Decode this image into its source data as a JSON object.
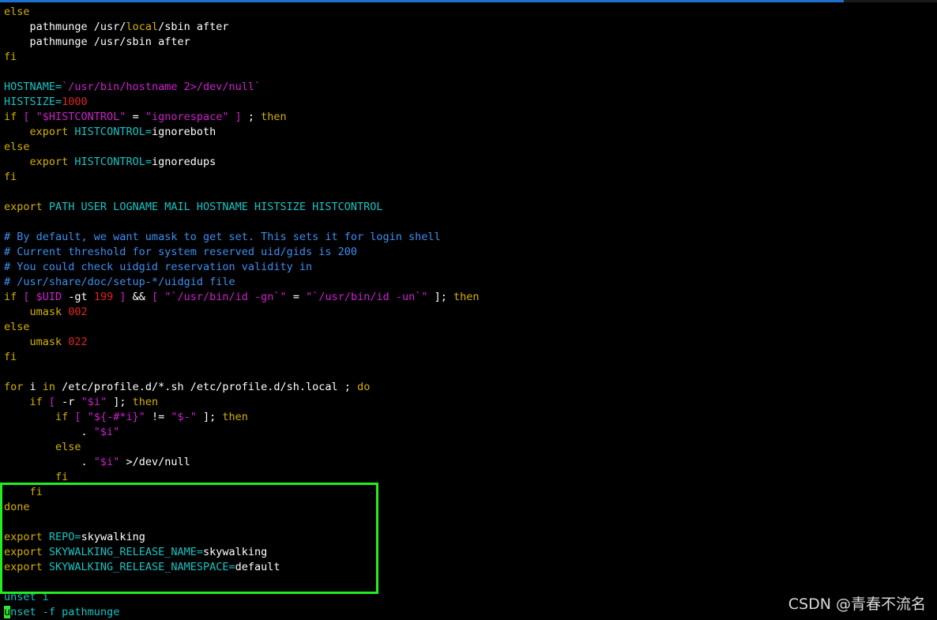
{
  "colors": {
    "background": "#000000",
    "keyword": "#d4b000",
    "variable": "#17c3c3",
    "string": "#d01fd0",
    "number": "#e0241f",
    "comment": "#3d8ef0",
    "text": "#ffffff",
    "highlight_border": "#22ee22",
    "cursor": "#33e633"
  },
  "editor": {
    "lines": [
      [
        {
          "t": "else",
          "c": "kw"
        }
      ],
      [
        {
          "t": "    pathmunge /usr/",
          "c": "txt"
        },
        {
          "t": "local",
          "c": "kw"
        },
        {
          "t": "/sbin after",
          "c": "txt"
        }
      ],
      [
        {
          "t": "    pathmunge /usr/sbin after",
          "c": "txt"
        }
      ],
      [
        {
          "t": "fi",
          "c": "kw"
        }
      ],
      [],
      [
        {
          "t": "HOSTNAME=",
          "c": "var"
        },
        {
          "t": "`/usr/bin/hostname 2>/dev/null`",
          "c": "str"
        }
      ],
      [
        {
          "t": "HISTSIZE=",
          "c": "var"
        },
        {
          "t": "1000",
          "c": "num"
        }
      ],
      [
        {
          "t": "if",
          "c": "kw"
        },
        {
          "t": " [ ",
          "c": "str"
        },
        {
          "t": "\"$HISTCONTROL\"",
          "c": "str"
        },
        {
          "t": " = ",
          "c": "txt"
        },
        {
          "t": "\"ignorespace\"",
          "c": "str"
        },
        {
          "t": " ] ",
          "c": "str"
        },
        {
          "t": "; ",
          "c": "txt"
        },
        {
          "t": "then",
          "c": "kw"
        }
      ],
      [
        {
          "t": "    ",
          "c": "txt"
        },
        {
          "t": "export",
          "c": "kw"
        },
        {
          "t": " HISTCONTROL=",
          "c": "var"
        },
        {
          "t": "ignoreboth",
          "c": "txt"
        }
      ],
      [
        {
          "t": "else",
          "c": "kw"
        }
      ],
      [
        {
          "t": "    ",
          "c": "txt"
        },
        {
          "t": "export",
          "c": "kw"
        },
        {
          "t": " HISTCONTROL=",
          "c": "var"
        },
        {
          "t": "ignoredups",
          "c": "txt"
        }
      ],
      [
        {
          "t": "fi",
          "c": "kw"
        }
      ],
      [],
      [
        {
          "t": "export",
          "c": "kw"
        },
        {
          "t": " PATH USER LOGNAME MAIL HOSTNAME HISTSIZE HISTCONTROL",
          "c": "var"
        }
      ],
      [],
      [
        {
          "t": "# By default, we want umask to get set. This sets it for login shell",
          "c": "com"
        }
      ],
      [
        {
          "t": "# Current threshold for system reserved uid/gids is 200",
          "c": "com"
        }
      ],
      [
        {
          "t": "# You could check uidgid reservation validity in",
          "c": "com"
        }
      ],
      [
        {
          "t": "# /usr/share/doc/setup-*/uidgid file",
          "c": "com"
        }
      ],
      [
        {
          "t": "if",
          "c": "kw"
        },
        {
          "t": " [ ",
          "c": "str"
        },
        {
          "t": "$UID",
          "c": "str"
        },
        {
          "t": " -gt ",
          "c": "txt"
        },
        {
          "t": "199",
          "c": "num"
        },
        {
          "t": " ] ",
          "c": "str"
        },
        {
          "t": "&& ",
          "c": "txt"
        },
        {
          "t": "[ ",
          "c": "str"
        },
        {
          "t": "\"`/usr/bin/id -gn`\"",
          "c": "str"
        },
        {
          "t": " = ",
          "c": "txt"
        },
        {
          "t": "\"`/usr/bin/id -un`\"",
          "c": "str"
        },
        {
          "t": " ]; ",
          "c": "txt"
        },
        {
          "t": "then",
          "c": "kw"
        }
      ],
      [
        {
          "t": "    umask ",
          "c": "kw"
        },
        {
          "t": "002",
          "c": "num"
        }
      ],
      [
        {
          "t": "else",
          "c": "kw"
        }
      ],
      [
        {
          "t": "    umask ",
          "c": "kw"
        },
        {
          "t": "022",
          "c": "num"
        }
      ],
      [
        {
          "t": "fi",
          "c": "kw"
        }
      ],
      [],
      [
        {
          "t": "for",
          "c": "kw"
        },
        {
          "t": " i ",
          "c": "txt"
        },
        {
          "t": "in",
          "c": "kw"
        },
        {
          "t": " /etc/profile.d/*.sh /etc/profile.d/sh.local ; ",
          "c": "txt"
        },
        {
          "t": "do",
          "c": "kw"
        }
      ],
      [
        {
          "t": "    ",
          "c": "txt"
        },
        {
          "t": "if",
          "c": "kw"
        },
        {
          "t": " [ ",
          "c": "str"
        },
        {
          "t": "-r ",
          "c": "txt"
        },
        {
          "t": "\"$i\"",
          "c": "str"
        },
        {
          "t": " ]; ",
          "c": "txt"
        },
        {
          "t": "then",
          "c": "kw"
        }
      ],
      [
        {
          "t": "        ",
          "c": "txt"
        },
        {
          "t": "if",
          "c": "kw"
        },
        {
          "t": " [ ",
          "c": "str"
        },
        {
          "t": "\"${-#*i}\"",
          "c": "str"
        },
        {
          "t": " != ",
          "c": "txt"
        },
        {
          "t": "\"$-\"",
          "c": "str"
        },
        {
          "t": " ]; ",
          "c": "txt"
        },
        {
          "t": "then",
          "c": "kw"
        }
      ],
      [
        {
          "t": "            . ",
          "c": "txt"
        },
        {
          "t": "\"$i\"",
          "c": "str"
        }
      ],
      [
        {
          "t": "        else",
          "c": "kw"
        }
      ],
      [
        {
          "t": "            . ",
          "c": "txt"
        },
        {
          "t": "\"$i\"",
          "c": "str"
        },
        {
          "t": " >/dev/null",
          "c": "txt"
        }
      ],
      [
        {
          "t": "        fi",
          "c": "kw"
        }
      ],
      [
        {
          "t": "    fi",
          "c": "kw"
        }
      ],
      [
        {
          "t": "done",
          "c": "kw"
        }
      ],
      [],
      [
        {
          "t": "export",
          "c": "kw"
        },
        {
          "t": " REPO=",
          "c": "var"
        },
        {
          "t": "skywalking",
          "c": "txt"
        }
      ],
      [
        {
          "t": "export",
          "c": "kw"
        },
        {
          "t": " SKYWALKING_RELEASE_NAME=",
          "c": "var"
        },
        {
          "t": "skywalking",
          "c": "txt"
        }
      ],
      [
        {
          "t": "export",
          "c": "kw"
        },
        {
          "t": " SKYWALKING_RELEASE_NAMESPACE=",
          "c": "var"
        },
        {
          "t": "default",
          "c": "txt"
        }
      ],
      [],
      [
        {
          "t": "unset i",
          "c": "var"
        }
      ],
      [
        {
          "t": "u",
          "c": "cursor"
        },
        {
          "t": "nset -f ",
          "c": "var"
        },
        {
          "t": "pathmunge",
          "c": "var"
        }
      ]
    ]
  },
  "watermark": {
    "text": "CSDN @青春不流名"
  }
}
